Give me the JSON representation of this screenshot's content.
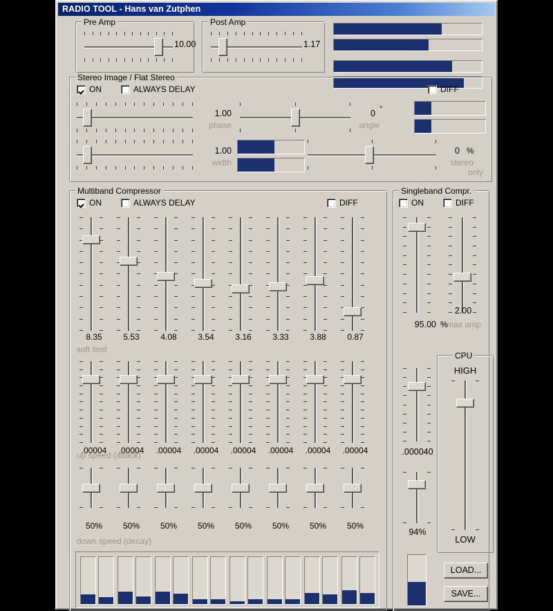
{
  "window": {
    "title": "RADIO TOOL - Hans van Zutphen"
  },
  "pre_amp": {
    "title": "Pre Amp",
    "value": "10.00",
    "pos_pct": 88
  },
  "post_amp": {
    "title": "Post Amp",
    "value": "1.17",
    "pos_pct": 9
  },
  "top_meters": [
    73,
    64,
    80,
    88
  ],
  "stereo": {
    "title": "Stereo Image / Flat Stereo",
    "on_label": "ON",
    "on_checked": true,
    "always_delay_label": "ALWAYS DELAY",
    "always_delay_checked": false,
    "diff_label": "DIFF",
    "diff_checked": false,
    "phase": {
      "value": "1.00",
      "label": "phase",
      "pos_pct": 6
    },
    "angle": {
      "value": "0",
      "unit": "°",
      "label": "angle",
      "pos_pct": 50
    },
    "angle_meters": [
      24,
      24
    ],
    "width": {
      "value": "1.00",
      "label": "width",
      "pos_pct": 6
    },
    "width_meters": [
      55,
      55
    ],
    "stereo_only": {
      "value": "0",
      "unit": "%",
      "label1": "stereo",
      "label2": "only",
      "pos_pct": 48
    }
  },
  "multiband": {
    "title": "Multiband Compressor",
    "on_label": "ON",
    "on_checked": true,
    "always_delay_label": "ALWAYS DELAY",
    "always_delay_checked": false,
    "diff_label": "DIFF",
    "diff_checked": false,
    "soft_limit": {
      "label": "soft limit",
      "values": [
        "8.35",
        "5.53",
        "4.08",
        "3.54",
        "3.16",
        "3.33",
        "3.88",
        "0.87"
      ],
      "pos_pct": [
        17,
        38,
        52,
        59,
        64,
        62,
        56,
        86
      ]
    },
    "up_speed": {
      "label": "up speed (attack)",
      "values": [
        ".00004",
        ".00004",
        ".00004",
        ".00004",
        ".00004",
        ".00004",
        ".00004",
        ".00004"
      ],
      "pos_pct": [
        19,
        19,
        19,
        19,
        19,
        19,
        19,
        19
      ]
    },
    "down_speed": {
      "label": "down speed (decay)",
      "values": [
        "50%",
        "50%",
        "50%",
        "50%",
        "50%",
        "50%",
        "50%",
        "50%"
      ],
      "pos_pct": [
        50,
        50,
        50,
        50,
        50,
        50,
        50,
        50
      ]
    },
    "band_meters": [
      [
        20,
        14
      ],
      [
        26,
        16
      ],
      [
        26,
        22
      ],
      [
        11,
        11
      ],
      [
        6,
        10
      ],
      [
        10,
        10
      ],
      [
        24,
        20
      ],
      [
        30,
        24
      ]
    ]
  },
  "singleband": {
    "title": "Singleband Compr.",
    "on_label": "ON",
    "on_checked": false,
    "diff_label": "DIFF",
    "diff_checked": false,
    "ratio": {
      "value": "95.00",
      "unit": "%",
      "pos_pct": 6
    },
    "max_amp": {
      "value": "2.00",
      "label": "max amp",
      "pos_pct": 64
    },
    "attack": {
      "value": ".000040",
      "pos_pct": 22
    },
    "decay": {
      "value": "94%",
      "pos_pct": 20
    },
    "meter": 46
  },
  "cpu": {
    "title": "CPU",
    "high_label": "HIGH",
    "low_label": "LOW",
    "pos_pct": 13
  },
  "buttons": {
    "load": "LOAD...",
    "save": "SAVE..."
  }
}
